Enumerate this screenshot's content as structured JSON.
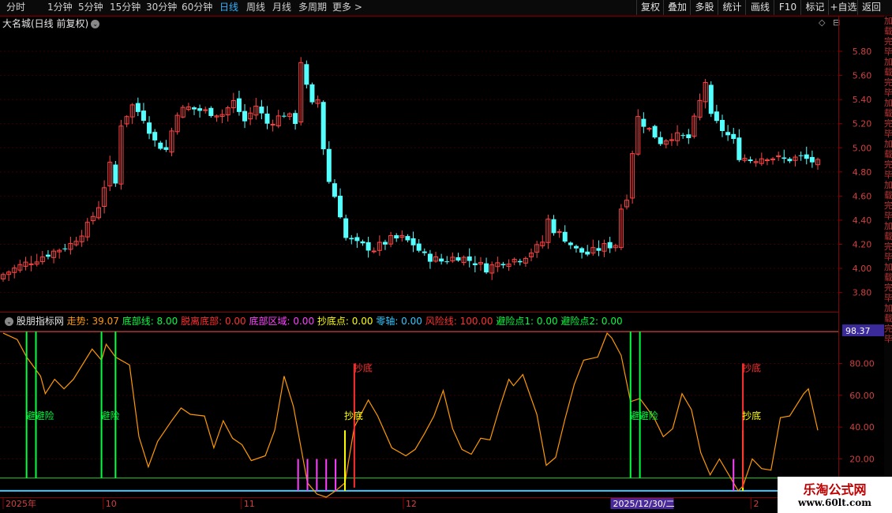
{
  "toolbar": {
    "periods": [
      "分时",
      "1分钟",
      "5分钟",
      "15分钟",
      "30分钟",
      "60分钟",
      "日线",
      "周线",
      "月线",
      "多周期",
      "更多 >"
    ],
    "active_period": "日线",
    "right_buttons": [
      "复权",
      "叠加",
      "多股",
      "统计",
      "画线",
      "F10",
      "标记",
      "+自选",
      "返回"
    ]
  },
  "main_chart": {
    "title": "大名城(日线 前复权)",
    "price_ticks": [
      "5.80",
      "5.60",
      "5.40",
      "5.20",
      "5.00",
      "4.80",
      "4.60",
      "4.40",
      "4.20",
      "4.00",
      "3.80"
    ],
    "price_tick_values": [
      5.8,
      5.6,
      5.4,
      5.2,
      5.0,
      4.8,
      4.6,
      4.4,
      4.2,
      4.0,
      3.8
    ],
    "ylim": [
      3.66,
      5.99
    ],
    "colors": {
      "up": "#ff4444",
      "down": "#54ffff",
      "grid": "#3a0000"
    }
  },
  "indicator": {
    "name": "股朋指标网",
    "legend": [
      {
        "label": "走势: 39.07",
        "color": "#ff9900"
      },
      {
        "label": "底部线: 8.00",
        "color": "#00ff40"
      },
      {
        "label": "脱离底部: 0.00",
        "color": "#ff3030"
      },
      {
        "label": "底部区域: 0.00",
        "color": "#ff40ff"
      },
      {
        "label": "抄底点: 0.00",
        "color": "#ffff00"
      },
      {
        "label": "零轴: 0.00",
        "color": "#30c8ff"
      },
      {
        "label": "风险线: 100.00",
        "color": "#ff3030"
      },
      {
        "label": "避险点1: 0.00",
        "color": "#00ff40"
      },
      {
        "label": "避险点2: 0.00",
        "color": "#00ff40"
      }
    ],
    "ticks": [
      "80.00",
      "60.00",
      "40.00",
      "20.00"
    ],
    "tick_values": [
      80,
      60,
      40,
      20
    ],
    "ylim": [
      -5,
      105
    ],
    "value_badge": "98.37",
    "annotations": [
      {
        "text": "避避险",
        "color": "#00ff40",
        "i": 5,
        "v": 45
      },
      {
        "text": "避险",
        "color": "#00ff40",
        "i": 21,
        "v": 45
      },
      {
        "text": "抄底",
        "color": "#ff3030",
        "i": 75,
        "v": 75
      },
      {
        "text": "抄底",
        "color": "#ffff00",
        "i": 73,
        "v": 45
      },
      {
        "text": "避避险",
        "color": "#00ff40",
        "i": 134,
        "v": 45
      },
      {
        "text": "抄底",
        "color": "#ff3030",
        "i": 158,
        "v": 75
      },
      {
        "text": "抄底",
        "color": "#ffff00",
        "i": 158,
        "v": 45
      }
    ]
  },
  "date_axis": {
    "labels": [
      {
        "text": "2025年",
        "i": 0
      },
      {
        "text": "10",
        "i": 21
      },
      {
        "text": "11",
        "i": 50
      },
      {
        "text": "12",
        "i": 84
      },
      {
        "text": "2",
        "i": 157
      }
    ],
    "cursor_label": "2025/12/30/二",
    "cursor_i": 128
  },
  "watermark": {
    "title": "乐淘公式网",
    "url": "www.60lt.com"
  },
  "right_strip_text": "加载完毕"
}
